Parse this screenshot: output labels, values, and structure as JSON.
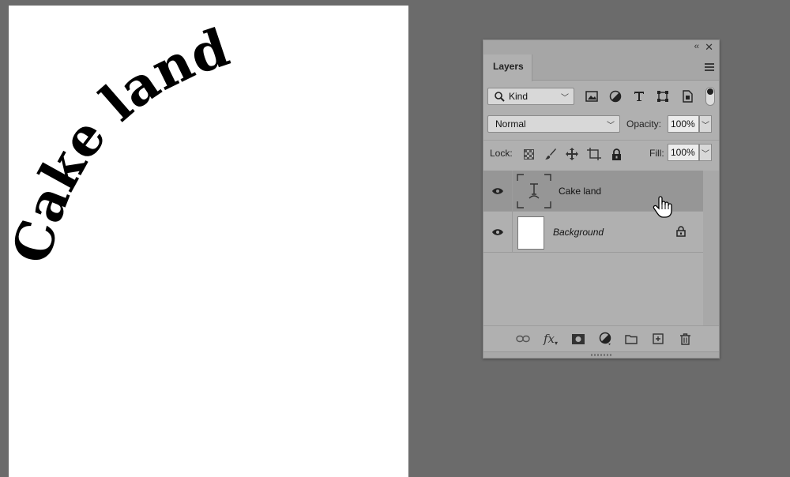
{
  "canvas": {
    "text": "Cake land",
    "text_color": "#000000",
    "background_color": "#ffffff"
  },
  "panel": {
    "collapse_icon": "double-chevron-left-icon",
    "close_icon": "close-icon",
    "tab_label": "Layers",
    "menu_icon": "hamburger-menu-icon",
    "filter": {
      "kind_label": "Kind",
      "icons": [
        "image-filter-icon",
        "adjustment-filter-icon",
        "type-filter-icon",
        "shape-filter-icon",
        "smart-object-filter-icon"
      ]
    },
    "blend": {
      "mode": "Normal",
      "opacity_label": "Opacity:",
      "opacity_value": "100%"
    },
    "lock": {
      "label": "Lock:",
      "icons": [
        "lock-transparent-icon",
        "lock-paint-icon",
        "lock-position-icon",
        "lock-artboard-icon",
        "lock-all-icon"
      ],
      "fill_label": "Fill:",
      "fill_value": "100%"
    },
    "layers": [
      {
        "name": "Cake land",
        "type": "text",
        "selected": true,
        "visible": true
      },
      {
        "name": "Background",
        "type": "background",
        "selected": false,
        "visible": true,
        "locked": true
      }
    ],
    "bottom_icons": [
      "link-layers-icon",
      "fx-icon",
      "layer-mask-icon",
      "adjustment-layer-icon",
      "new-group-icon",
      "new-layer-icon",
      "delete-layer-icon"
    ],
    "fx_label": "fx",
    "background_color": "#b0b0b0",
    "selected_row_color": "#969696"
  },
  "workspace_color": "#6b6b6b"
}
